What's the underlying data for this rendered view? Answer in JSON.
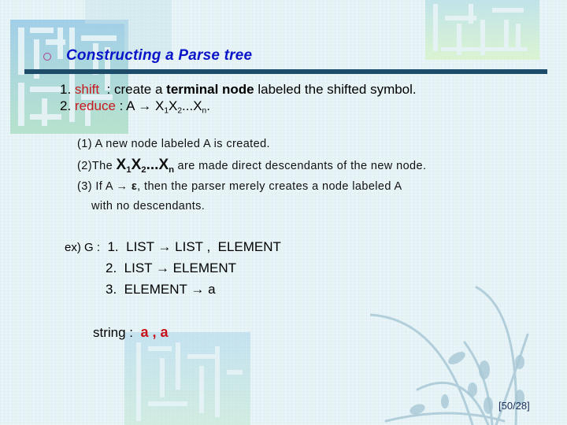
{
  "slide": {
    "title": "Constructing a Parse tree",
    "steps": [
      {
        "number": "1.",
        "keyword": "shift",
        "separator": "  : create a ",
        "bold_text": "terminal node",
        "rest": " labeled the shifted symbol."
      },
      {
        "number": "2.",
        "keyword": "reduce",
        "separator": " : A → ",
        "production_symbol": "X",
        "subscripts": [
          "1",
          "2",
          "n"
        ],
        "ellipsis": "...",
        "end": "."
      }
    ],
    "reduce_details": [
      {
        "label": "(1)",
        "text": "A new node labeled A is created."
      },
      {
        "label": "(2)",
        "prefix": "The ",
        "symbol": "X",
        "subscripts": [
          "1",
          "2",
          "n"
        ],
        "ellipsis": "...",
        "text": " are made direct descendants of the new node."
      },
      {
        "label": "(3)",
        "text": "If A → ",
        "epsilon": "ε",
        "rest": ", then the parser merely creates a node labeled A"
      },
      {
        "text": "with no descendants."
      }
    ],
    "example": {
      "prefix": "ex) G :",
      "rules": [
        {
          "number": "1.",
          "text": "LIST → LIST ,  ELEMENT"
        },
        {
          "number": "2.",
          "text": "LIST → ELEMENT"
        },
        {
          "number": "3.",
          "text": "ELEMENT → a"
        }
      ]
    },
    "string": {
      "label": "string :",
      "value": "a , a"
    },
    "page_number": "[50/28]"
  },
  "colors": {
    "title": "#0a14c8",
    "title_bar": "#1d4c6b",
    "keyword": "#c8181e",
    "bullet": "#b0408a",
    "background": "#e6f3f6"
  },
  "icons": {
    "bullet": "hollow-circle",
    "decorations": [
      "maze-pattern",
      "plant-silhouette"
    ]
  }
}
